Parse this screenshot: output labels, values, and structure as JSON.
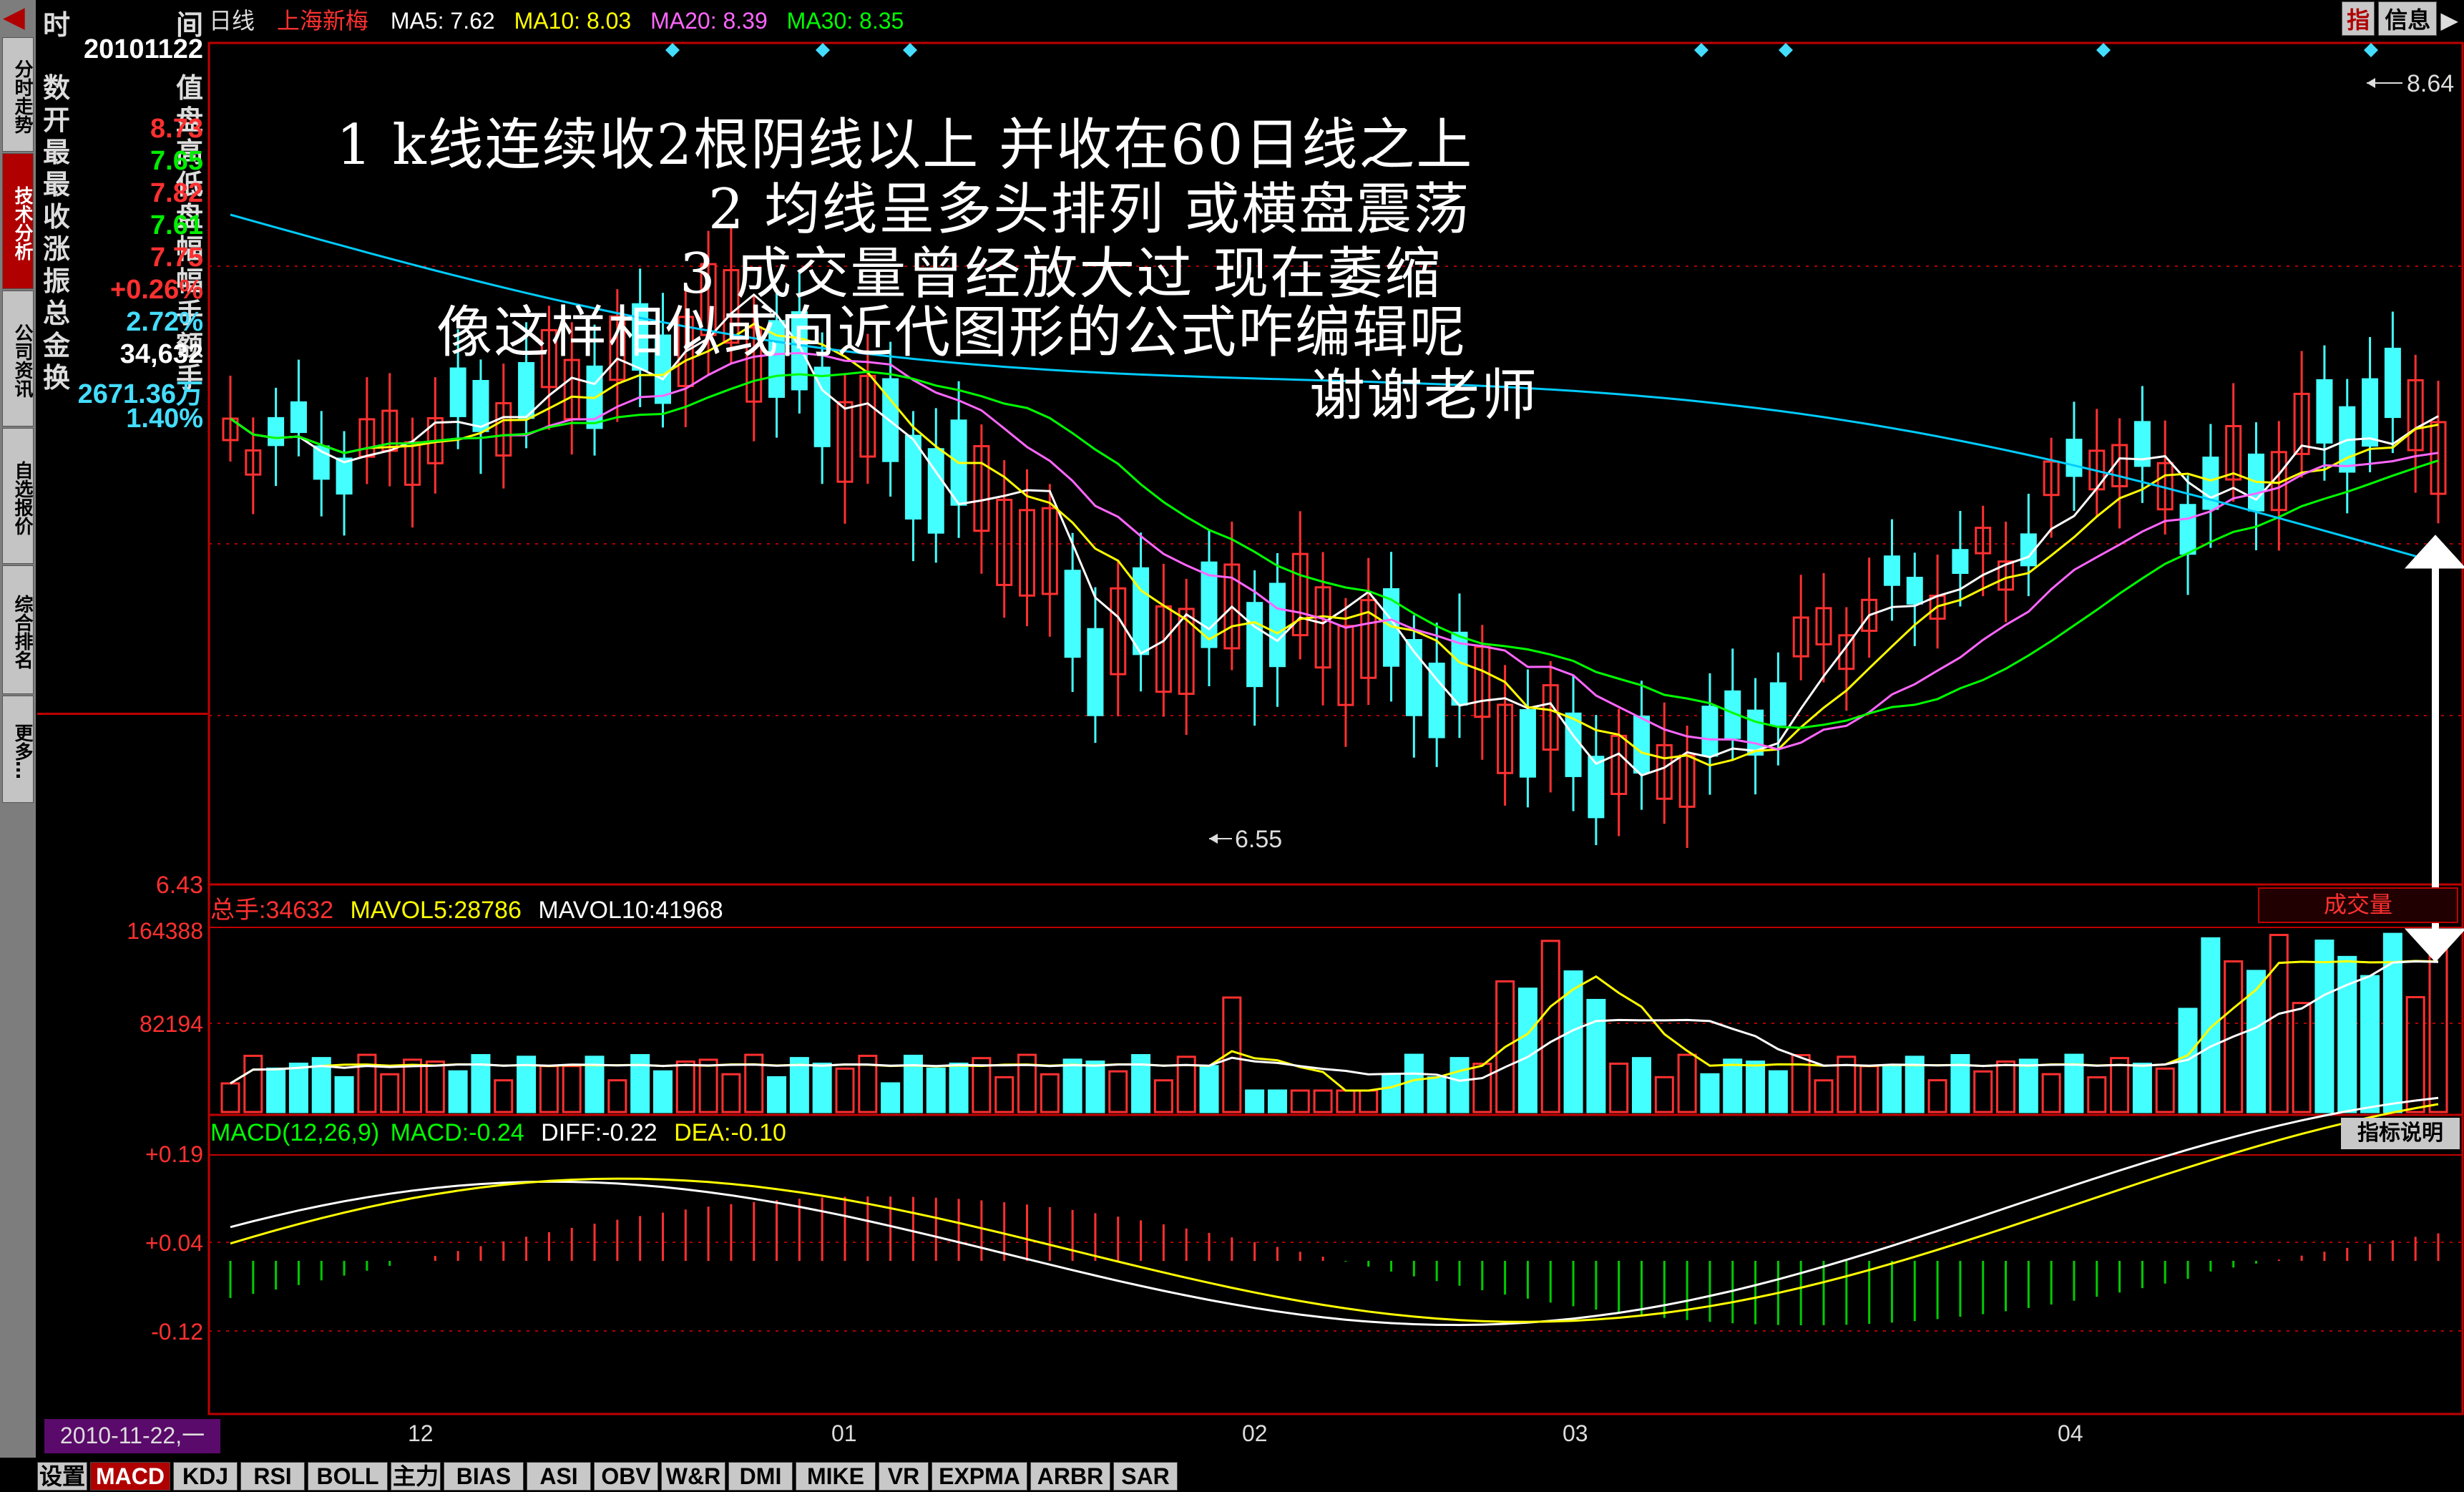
{
  "header": {
    "period": "日线",
    "stock_name": "上海新梅",
    "ma5_label": "MA5:",
    "ma5": "7.62",
    "ma10_label": "MA10:",
    "ma10": "8.03",
    "ma20_label": "MA20:",
    "ma20": "8.39",
    "ma30_label": "MA30:",
    "ma30": "8.35",
    "btn_zhi": "指",
    "btn_info": "信息"
  },
  "nav": [
    {
      "label": "分时走势"
    },
    {
      "label": "技术分析",
      "active": true
    },
    {
      "label": "公司资讯"
    },
    {
      "label": "自选报价"
    },
    {
      "label": "综合排名"
    },
    {
      "label": "更多…"
    }
  ],
  "info": {
    "time_label": "时",
    "time_label2": "间",
    "date": "20101122",
    "rows": [
      {
        "l": "数",
        "r": "值",
        "v": ""
      },
      {
        "l": "开",
        "r": "盘",
        "v": "8.73",
        "c": "#ff3030"
      },
      {
        "l": "最",
        "r": "高",
        "v": "7.65",
        "c": "#00ee00"
      },
      {
        "l": "最",
        "r": "低",
        "v": "7.82",
        "c": "#ff3030"
      },
      {
        "l": "收",
        "r": "盘",
        "v": "7.61",
        "c": "#00ee00"
      },
      {
        "l": "涨",
        "r": "幅",
        "v": "7.75",
        "c": "#ff3030"
      },
      {
        "l": "振",
        "r": "幅",
        "v": "+0.26%",
        "c": "#ff3030"
      },
      {
        "l": "总",
        "r": "手",
        "v": "2.72%",
        "c": "#44ddff"
      },
      {
        "l": "金",
        "r": "额",
        "v": "34,632",
        "c": "#ffffff"
      },
      {
        "l": "换",
        "r": "手",
        "v": "2671.36万",
        "c": "#44ddff"
      },
      {
        "l": "",
        "r": "",
        "v": "1.40%",
        "c": "#44ddff"
      }
    ]
  },
  "price_axis": {
    "top_label": "8.64",
    "low_label": "6.55",
    "bottom": "6.43"
  },
  "volume": {
    "title_label": "总手:",
    "total": "34632",
    "mavol5_label": "MAVOL5:",
    "mavol5": "28786",
    "mavol10_label": "MAVOL10:",
    "mavol10": "41968",
    "button": "成交量",
    "ticks": [
      "164388",
      "82194"
    ]
  },
  "macd": {
    "title": "MACD(12,26,9)",
    "macd_label": "MACD:",
    "macd": "-0.24",
    "diff_label": "DIFF:",
    "diff": "-0.22",
    "dea_label": "DEA:",
    "dea": "-0.10",
    "button": "指标说明",
    "ticks": [
      "+0.19",
      "+0.04",
      "-0.12"
    ]
  },
  "x_axis": {
    "labels": [
      "12",
      "01",
      "02",
      "03",
      "04"
    ]
  },
  "date_display": "2010-11-22,一",
  "overlay": [
    "1 k线连续收2根阴线以上 并收在60日线之上",
    "2 均线呈多头排列 或横盘震荡",
    "3 成交量曾经放大过 现在萎缩",
    "像这样相似或向近代图形的公式咋编辑呢",
    "谢谢老师"
  ],
  "tabs": [
    "设置",
    "MACD",
    "KDJ",
    "RSI",
    "BOLL",
    "主力",
    "BIAS",
    "ASI",
    "OBV",
    "W&R",
    "DMI",
    "MIKE",
    "VR",
    "EXPMA",
    "ARBR",
    "SAR"
  ],
  "colors": {
    "up": "#ff3030",
    "down": "#44ffff",
    "ma5": "#ffffff",
    "ma10": "#ffff00",
    "ma20": "#ff66ff",
    "ma30": "#00ff00",
    "ma60": "#00ccff"
  }
}
